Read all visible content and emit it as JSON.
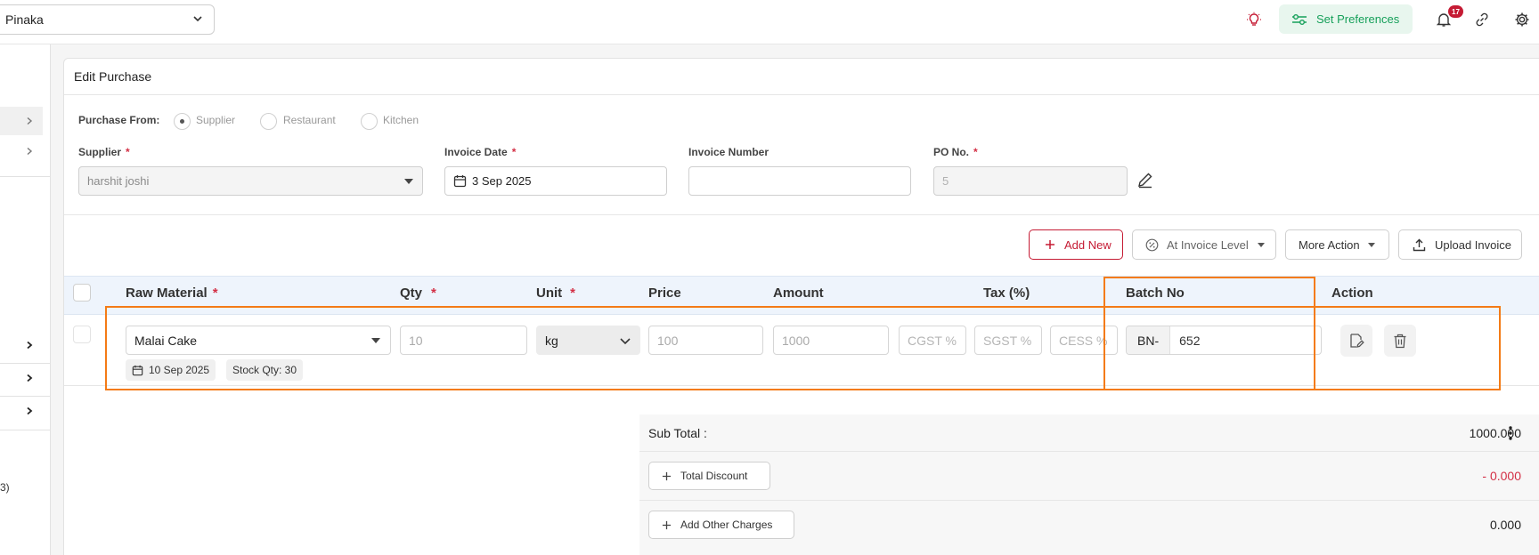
{
  "topbar": {
    "outlet": "Pinaka",
    "set_preferences": "Set Preferences",
    "notification_count": "17",
    "accent": "#16a05a"
  },
  "sidebar": {
    "partial_text": "3)"
  },
  "page": {
    "title": "Edit Purchase"
  },
  "purchase_from": {
    "label": "Purchase From:",
    "options": [
      "Supplier",
      "Restaurant",
      "Kitchen"
    ],
    "selected": "Supplier"
  },
  "fields": {
    "supplier": {
      "label": "Supplier",
      "value": "harshit joshi"
    },
    "invoice_date": {
      "label": "Invoice Date",
      "value": "3 Sep 2025"
    },
    "invoice_number": {
      "label": "Invoice Number",
      "value": ""
    },
    "po_no": {
      "label": "PO No.",
      "value": "5"
    }
  },
  "actions": {
    "add_new": "Add New",
    "at_invoice_level": "At Invoice Level",
    "more_action": "More Action",
    "upload_invoice": "Upload Invoice"
  },
  "table": {
    "headers": {
      "raw_material": "Raw Material",
      "qty": "Qty",
      "unit": "Unit",
      "price": "Price",
      "amount": "Amount",
      "tax": "Tax (%)",
      "batch_no": "Batch No",
      "action": "Action"
    },
    "rows": [
      {
        "raw_material": "Malai Cake",
        "qty": "10",
        "unit": "kg",
        "price": "100",
        "amount": "1000",
        "cgst_placeholder": "CGST %",
        "sgst_placeholder": "SGST %",
        "cess_placeholder": "CESS %",
        "batch_prefix": "BN-",
        "batch_value": "652",
        "expiry_date": "10 Sep 2025",
        "stock_qty": "Stock Qty: 30"
      }
    ]
  },
  "totals": {
    "sub_total_label": "Sub Total :",
    "sub_total_value": "1000.000",
    "total_discount_label": "Total Discount",
    "total_discount_value": "- 0.000",
    "other_charges_label": "Add Other Charges",
    "other_charges_value": "0.000"
  },
  "colors": {
    "highlight": "#f47b16",
    "danger": "#c51b34"
  }
}
